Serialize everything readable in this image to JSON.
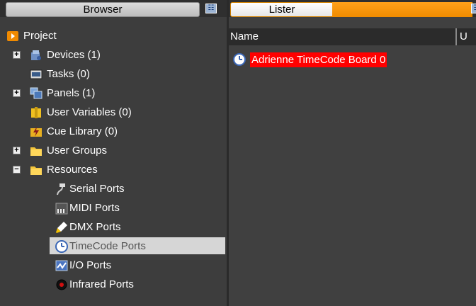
{
  "browser_panel": {
    "tab_label": "Browser",
    "root_label": "Project",
    "items": [
      {
        "label": "Devices (1)",
        "icon": "devices-icon",
        "expander": "+"
      },
      {
        "label": "Tasks (0)",
        "icon": "tasks-icon",
        "expander": ""
      },
      {
        "label": "Panels (1)",
        "icon": "panels-icon",
        "expander": "+"
      },
      {
        "label": "User Variables (0)",
        "icon": "user-variables-icon",
        "expander": ""
      },
      {
        "label": "Cue Library (0)",
        "icon": "cue-library-icon",
        "expander": ""
      },
      {
        "label": "User Groups",
        "icon": "folder-icon",
        "expander": "+"
      },
      {
        "label": "Resources",
        "icon": "folder-icon",
        "expander": "−"
      }
    ],
    "resources": [
      {
        "label": "Serial Ports",
        "icon": "serial-port-icon"
      },
      {
        "label": "MIDI Ports",
        "icon": "midi-port-icon"
      },
      {
        "label": "DMX Ports",
        "icon": "dmx-port-icon"
      },
      {
        "label": "TimeCode Ports",
        "icon": "clock-icon",
        "selected": true
      },
      {
        "label": "I/O Ports",
        "icon": "io-port-icon"
      },
      {
        "label": "Infrared Ports",
        "icon": "infrared-port-icon"
      }
    ]
  },
  "lister_panel": {
    "tab_label": "Lister",
    "columns": [
      "Name",
      "U"
    ],
    "rows": [
      {
        "name": "Adrienne TimeCode Board 0",
        "icon": "clock-icon",
        "highlight": "#ff0000"
      }
    ]
  },
  "colors": {
    "accent": "#f0900a",
    "selection": "#d6d6d6",
    "highlight": "#ff0000",
    "background": "#404040"
  }
}
